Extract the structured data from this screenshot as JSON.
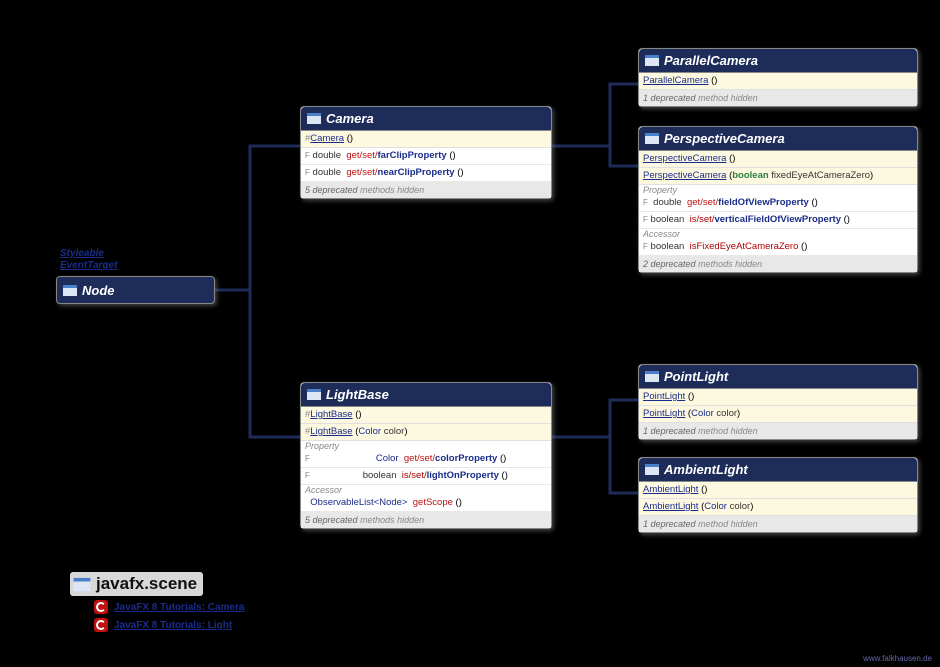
{
  "interfaces": {
    "i1": "Styleable",
    "i2": "EventTarget"
  },
  "node": {
    "title": "Node"
  },
  "camera": {
    "title": "Camera",
    "ctor": "Camera",
    "p1_type": "double",
    "p1_gs": "get/set/",
    "p1_name": "farClipProperty",
    "p2_type": "double",
    "p2_gs": "get/set/",
    "p2_name": "nearClipProperty",
    "depr": "5 deprecated",
    "depr2": "methods hidden"
  },
  "parallel": {
    "title": "ParallelCamera",
    "ctor": "ParallelCamera",
    "depr": "1 deprecated",
    "depr2": "method hidden"
  },
  "perspective": {
    "title": "PerspectiveCamera",
    "ctor1": "PerspectiveCamera",
    "ctor2": "PerspectiveCamera",
    "ctor2_ptype": "boolean",
    "ctor2_pname": "fixedEyeAtCameraZero",
    "sect1": "Property",
    "p1_type": "double",
    "p1_gs": "get/set/",
    "p1_name": "fieldOfViewProperty",
    "p2_type": "boolean",
    "p2_is": "is/set/",
    "p2_name": "verticalFieldOfViewProperty",
    "sect2": "Accessor",
    "a1_type": "boolean",
    "a1_is": "isFixedEyeAtCameraZero",
    "depr": "2 deprecated",
    "depr2": "methods hidden"
  },
  "lightbase": {
    "title": "LightBase",
    "ctor1": "LightBase",
    "ctor2": "LightBase",
    "ctor2_ptype": "Color",
    "ctor2_pname": "color",
    "sect1": "Property",
    "p1_type": "Color",
    "p1_gs": "get/set/",
    "p1_name": "colorProperty",
    "p2_type": "boolean",
    "p2_is": "is/set/",
    "p2_name": "lightOnProperty",
    "sect2": "Accessor",
    "a1_type": "ObservableList",
    "a1_gen": "<Node>",
    "a1_name": "getScope",
    "depr": "5 deprecated",
    "depr2": "methods hidden"
  },
  "pointlight": {
    "title": "PointLight",
    "ctor1": "PointLight",
    "ctor2": "PointLight",
    "ctor2_ptype": "Color",
    "ctor2_pname": "color",
    "depr": "1 deprecated",
    "depr2": "method hidden"
  },
  "ambientlight": {
    "title": "AmbientLight",
    "ctor1": "AmbientLight",
    "ctor2": "AmbientLight",
    "ctor2_ptype": "Color",
    "ctor2_pname": "color",
    "depr": "1 deprecated",
    "depr2": "method hidden"
  },
  "pkg": {
    "name": "javafx.scene"
  },
  "tut1": "JavaFX 8 Tutorials: Camera",
  "tut2": "JavaFX 8 Tutorials: Light",
  "footer": "www.falkhausen.de",
  "hash": "#",
  "F": "F",
  "parens": "()",
  "lparen": "(",
  "rparen": ")",
  "sp": " "
}
